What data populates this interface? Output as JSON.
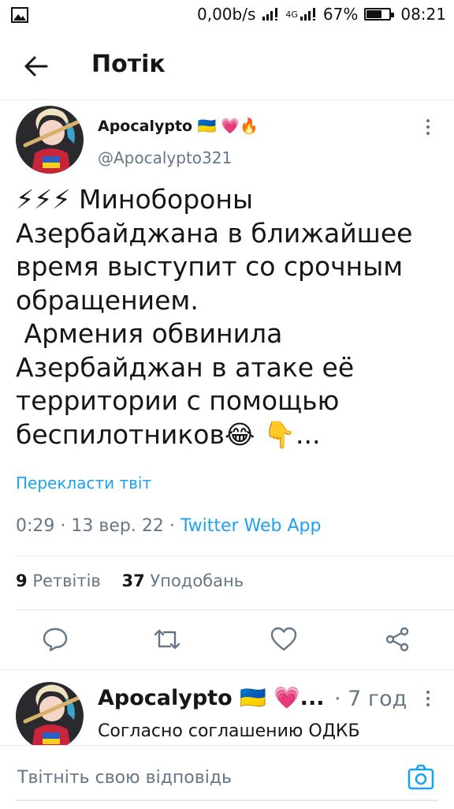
{
  "status_bar": {
    "speed": "0,00b/s",
    "network": "4G",
    "battery": "67%",
    "battery_level": 0.67,
    "time": "08:21"
  },
  "header": {
    "title": "Потік"
  },
  "tweet": {
    "author_name": "Apocalypto",
    "author_emojis": "🇺🇦 💗🔥",
    "handle": "@Apocalypto321",
    "text_lines": [
      "⚡⚡⚡ Минобороны",
      "Азербайджана в ближайшее",
      "время выступит со срочным",
      "обращением.",
      " Армения обвинила",
      "Азербайджан в атаке её",
      "территории с помощью",
      "беспилотников😂 👇..."
    ],
    "translate_label": "Перекласти твіт",
    "time": "0:29",
    "date": "13 вер. 22",
    "source": "Twitter Web App",
    "retweets_count": "9",
    "retweets_label": "Ретвітів",
    "likes_count": "37",
    "likes_label": "Уподобань"
  },
  "reply": {
    "author_name": "Apocalypto",
    "author_emojis": "🇺🇦 💗...",
    "time_ago": "· 7 год",
    "text": "Согласно соглашению ОДКБ"
  },
  "composer": {
    "placeholder": "Твітніть свою відповідь"
  },
  "colors": {
    "accent": "#1da1f2",
    "secondary_text": "#657786",
    "divider": "#e6ecf0"
  }
}
